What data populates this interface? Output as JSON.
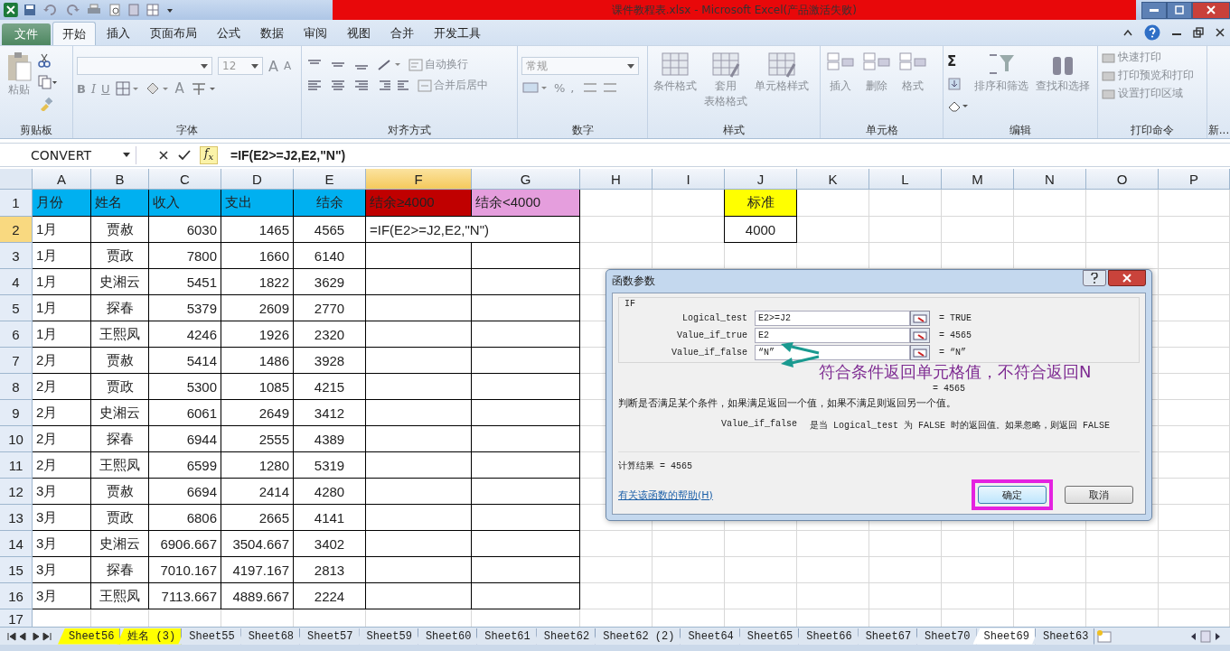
{
  "window": {
    "title": "课件教程表.xlsx - Microsoft Excel(产品激活失败)"
  },
  "menu_tabs": [
    {
      "label": "文件",
      "kind": "file",
      "selected": false
    },
    {
      "label": "开始",
      "kind": "tab",
      "selected": true
    },
    {
      "label": "插入",
      "kind": "tab",
      "selected": false
    },
    {
      "label": "页面布局",
      "kind": "tab",
      "selected": false
    },
    {
      "label": "公式",
      "kind": "tab",
      "selected": false
    },
    {
      "label": "数据",
      "kind": "tab",
      "selected": false
    },
    {
      "label": "审阅",
      "kind": "tab",
      "selected": false
    },
    {
      "label": "视图",
      "kind": "tab",
      "selected": false
    },
    {
      "label": "合并",
      "kind": "tab",
      "selected": false
    },
    {
      "label": "开发工具",
      "kind": "tab",
      "selected": false
    }
  ],
  "ribbon": {
    "clipboard": {
      "label": "剪贴板",
      "paste": "粘贴"
    },
    "font": {
      "label": "字体",
      "size": "12",
      "grow": "A",
      "shrink": "A",
      "styles": [
        "B",
        "I",
        "U"
      ],
      "font_color": "A"
    },
    "alignment": {
      "label": "对齐方式",
      "wrap": "自动换行",
      "merge": "合并后居中"
    },
    "number": {
      "label": "数字",
      "format": "常规",
      "percent": "%",
      "comma": ","
    },
    "styles": {
      "label": "样式",
      "buttons": [
        [
          "条件格式"
        ],
        [
          "套用",
          "表格格式"
        ],
        [
          "单元格样式"
        ]
      ]
    },
    "cells": {
      "label": "单元格",
      "buttons": [
        "插入",
        "删除",
        "格式"
      ]
    },
    "editing": {
      "label": "编辑",
      "sum": "Σ",
      "buttons": [
        "排序和筛选",
        "查找和选择"
      ]
    },
    "print": {
      "label": "打印命令",
      "items": [
        "快速打印",
        "打印预览和打印",
        "设置打印区域"
      ]
    },
    "more": {
      "label": "新..."
    }
  },
  "formula_bar": {
    "name_box": "CONVERT",
    "fx": "f$_{x}$",
    "formula": "=IF(E2>=J2,E2,\"N\")"
  },
  "columns": [
    {
      "label": "A",
      "selected": false
    },
    {
      "label": "B",
      "selected": false
    },
    {
      "label": "C",
      "selected": false
    },
    {
      "label": "D",
      "selected": false
    },
    {
      "label": "E",
      "selected": false
    },
    {
      "label": "F",
      "selected": true
    },
    {
      "label": "G",
      "selected": false
    },
    {
      "label": "H",
      "selected": false
    },
    {
      "label": "I",
      "selected": false
    },
    {
      "label": "J",
      "selected": false
    },
    {
      "label": "K",
      "selected": false
    },
    {
      "label": "L",
      "selected": false
    },
    {
      "label": "M",
      "selected": false
    },
    {
      "label": "N",
      "selected": false
    },
    {
      "label": "O",
      "selected": false
    },
    {
      "label": "P",
      "selected": false
    }
  ],
  "rows": [
    {
      "number": "1",
      "selected": false,
      "cells": {
        "A": {
          "text": "月份",
          "color": "#00b0f0"
        },
        "B": {
          "text": "姓名",
          "color": "#00b0f0"
        },
        "C": {
          "text": "收入",
          "color": "#00b0f0"
        },
        "D": {
          "text": "支出",
          "color": "#00b0f0"
        },
        "E": {
          "text": "结余",
          "color": "#00b0f0"
        },
        "F": {
          "text": "结余≥4000",
          "color": "#c00000"
        },
        "G": {
          "text": "结余<4000",
          "color": "#e59edd"
        },
        "J": {
          "text": "标准",
          "color": "#ffff00"
        }
      }
    },
    {
      "number": "2",
      "selected": true,
      "cells": {
        "A": {
          "text": "1月"
        },
        "B": {
          "text": "贾赦"
        },
        "C": {
          "text": "6030"
        },
        "D": {
          "text": "1465"
        },
        "E": {
          "text": "4565"
        },
        "F": {
          "text": "=IF(E2>=J2,E2,\"N\")"
        },
        "J": {
          "text": "4000"
        }
      }
    },
    {
      "number": "3",
      "selected": false,
      "cells": {
        "A": {
          "text": "1月"
        },
        "B": {
          "text": "贾政"
        },
        "C": {
          "text": "7800"
        },
        "D": {
          "text": "1660"
        },
        "E": {
          "text": "6140"
        }
      }
    },
    {
      "number": "4",
      "selected": false,
      "cells": {
        "A": {
          "text": "1月"
        },
        "B": {
          "text": "史湘云"
        },
        "C": {
          "text": "5451"
        },
        "D": {
          "text": "1822"
        },
        "E": {
          "text": "3629"
        }
      }
    },
    {
      "number": "5",
      "selected": false,
      "cells": {
        "A": {
          "text": "1月"
        },
        "B": {
          "text": "探春"
        },
        "C": {
          "text": "5379"
        },
        "D": {
          "text": "2609"
        },
        "E": {
          "text": "2770"
        }
      }
    },
    {
      "number": "6",
      "selected": false,
      "cells": {
        "A": {
          "text": "1月"
        },
        "B": {
          "text": "王熙凤"
        },
        "C": {
          "text": "4246"
        },
        "D": {
          "text": "1926"
        },
        "E": {
          "text": "2320"
        }
      }
    },
    {
      "number": "7",
      "selected": false,
      "cells": {
        "A": {
          "text": "2月"
        },
        "B": {
          "text": "贾赦"
        },
        "C": {
          "text": "5414"
        },
        "D": {
          "text": "1486"
        },
        "E": {
          "text": "3928"
        }
      }
    },
    {
      "number": "8",
      "selected": false,
      "cells": {
        "A": {
          "text": "2月"
        },
        "B": {
          "text": "贾政"
        },
        "C": {
          "text": "5300"
        },
        "D": {
          "text": "1085"
        },
        "E": {
          "text": "4215"
        }
      }
    },
    {
      "number": "9",
      "selected": false,
      "cells": {
        "A": {
          "text": "2月"
        },
        "B": {
          "text": "史湘云"
        },
        "C": {
          "text": "6061"
        },
        "D": {
          "text": "2649"
        },
        "E": {
          "text": "3412"
        }
      }
    },
    {
      "number": "10",
      "selected": false,
      "cells": {
        "A": {
          "text": "2月"
        },
        "B": {
          "text": "探春"
        },
        "C": {
          "text": "6944"
        },
        "D": {
          "text": "2555"
        },
        "E": {
          "text": "4389"
        }
      }
    },
    {
      "number": "11",
      "selected": false,
      "cells": {
        "A": {
          "text": "2月"
        },
        "B": {
          "text": "王熙凤"
        },
        "C": {
          "text": "6599"
        },
        "D": {
          "text": "1280"
        },
        "E": {
          "text": "5319"
        }
      }
    },
    {
      "number": "12",
      "selected": false,
      "cells": {
        "A": {
          "text": "3月"
        },
        "B": {
          "text": "贾赦"
        },
        "C": {
          "text": "6694"
        },
        "D": {
          "text": "2414"
        },
        "E": {
          "text": "4280"
        }
      }
    },
    {
      "number": "13",
      "selected": false,
      "cells": {
        "A": {
          "text": "3月"
        },
        "B": {
          "text": "贾政"
        },
        "C": {
          "text": "6806"
        },
        "D": {
          "text": "2665"
        },
        "E": {
          "text": "4141"
        }
      }
    },
    {
      "number": "14",
      "selected": false,
      "cells": {
        "A": {
          "text": "3月"
        },
        "B": {
          "text": "史湘云"
        },
        "C": {
          "text": "6906.667"
        },
        "D": {
          "text": "3504.667"
        },
        "E": {
          "text": "3402"
        }
      }
    },
    {
      "number": "15",
      "selected": false,
      "cells": {
        "A": {
          "text": "3月"
        },
        "B": {
          "text": "探春"
        },
        "C": {
          "text": "7010.167"
        },
        "D": {
          "text": "4197.167"
        },
        "E": {
          "text": "2813"
        }
      }
    },
    {
      "number": "16",
      "selected": false,
      "cells": {
        "A": {
          "text": "3月"
        },
        "B": {
          "text": "王熙凤"
        },
        "C": {
          "text": "7113.667"
        },
        "D": {
          "text": "4889.667"
        },
        "E": {
          "text": "2224"
        }
      }
    },
    {
      "number": "17",
      "selected": false,
      "cells": {}
    }
  ],
  "sheet_tabs": [
    {
      "label": "Sheet56",
      "selected": false,
      "color": "#ffff00"
    },
    {
      "label": "姓名 (3)",
      "selected": false,
      "color": "#ffff00"
    },
    {
      "label": "Sheet55",
      "selected": false
    },
    {
      "label": "Sheet68",
      "selected": false
    },
    {
      "label": "Sheet57",
      "selected": false
    },
    {
      "label": "Sheet59",
      "selected": false
    },
    {
      "label": "Sheet60",
      "selected": false
    },
    {
      "label": "Sheet61",
      "selected": false
    },
    {
      "label": "Sheet62",
      "selected": false
    },
    {
      "label": "Sheet62 (2)",
      "selected": false
    },
    {
      "label": "Sheet64",
      "selected": false
    },
    {
      "label": "Sheet65",
      "selected": false
    },
    {
      "label": "Sheet66",
      "selected": false
    },
    {
      "label": "Sheet67",
      "selected": false
    },
    {
      "label": "Sheet70",
      "selected": false
    },
    {
      "label": "Sheet69",
      "selected": true
    },
    {
      "label": "Sheet63",
      "selected": false
    }
  ],
  "dialog": {
    "title": "函数参数",
    "function": "IF",
    "arguments": [
      {
        "label": "Logical_test",
        "value": "E2>=J2",
        "result": "= TRUE"
      },
      {
        "label": "Value_if_true",
        "value": "E2",
        "result": "= 4565"
      },
      {
        "label": "Value_if_false",
        "value": "“N”",
        "result": "= “N”"
      }
    ],
    "formula_result": "= 4565",
    "description": "判断是否满足某个条件，如果满足返回一个值，如果不满足则返回另一个值。",
    "argument_name": "Value_if_false",
    "argument_help": "是当 Logical_test 为 FALSE 时的返回值。如果忽略，则返回 FALSE",
    "result_line": "计算结果 =  4565",
    "help_link": "有关该函数的帮助(H)",
    "buttons": [
      {
        "label": "确定",
        "highlighted": true
      },
      {
        "label": "取消",
        "highlighted": false
      }
    ]
  },
  "annotation": {
    "text": "符合条件返回单元格值，不符合返回N"
  }
}
